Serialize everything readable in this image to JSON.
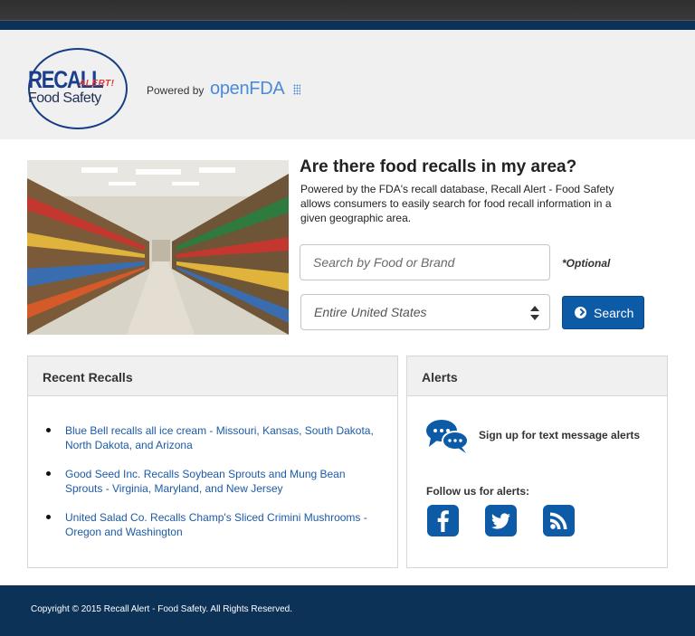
{
  "header": {
    "logo": {
      "main": "RECALL",
      "tag": "ALERT!",
      "sub": "Food Safety"
    },
    "powered_by": "Powered by",
    "provider": "openFDA"
  },
  "hero": {
    "title": "Are there food recalls in my area?",
    "description": "Powered by the FDA's recall database, Recall Alert - Food Safety allows consumers to easily search for food recall information in a given geographic area."
  },
  "search": {
    "placeholder": "Search by Food or Brand",
    "optional_label": "*Optional",
    "region_value": "Entire United States",
    "button_label": "Search"
  },
  "recent_recalls": {
    "title": "Recent Recalls",
    "items": [
      "Blue Bell recalls all ice cream - Missouri, Kansas, South Dakota, North Dakota, and Arizona",
      "Good Seed Inc. Recalls Soybean Sprouts and Mung Bean Sprouts - Virginia, Maryland, and New Jersey",
      "United Salad Co. Recalls Champ's Sliced Crimini Mushrooms - Oregon and Washington"
    ]
  },
  "alerts": {
    "title": "Alerts",
    "signup_text": "Sign up for text message alerts",
    "follow_text": "Follow us for alerts:",
    "icons": [
      "chat-bubbles-icon",
      "facebook-icon",
      "twitter-icon",
      "rss-icon"
    ]
  },
  "footer": {
    "copyright": "Copyright © 2015 Recall Alert - Food Safety. All Rights Reserved."
  },
  "colors": {
    "navy": "#0d3257",
    "brand_blue": "#0d5aa7",
    "link": "#1c5aa5",
    "panel_head": "#f0f0f0"
  }
}
